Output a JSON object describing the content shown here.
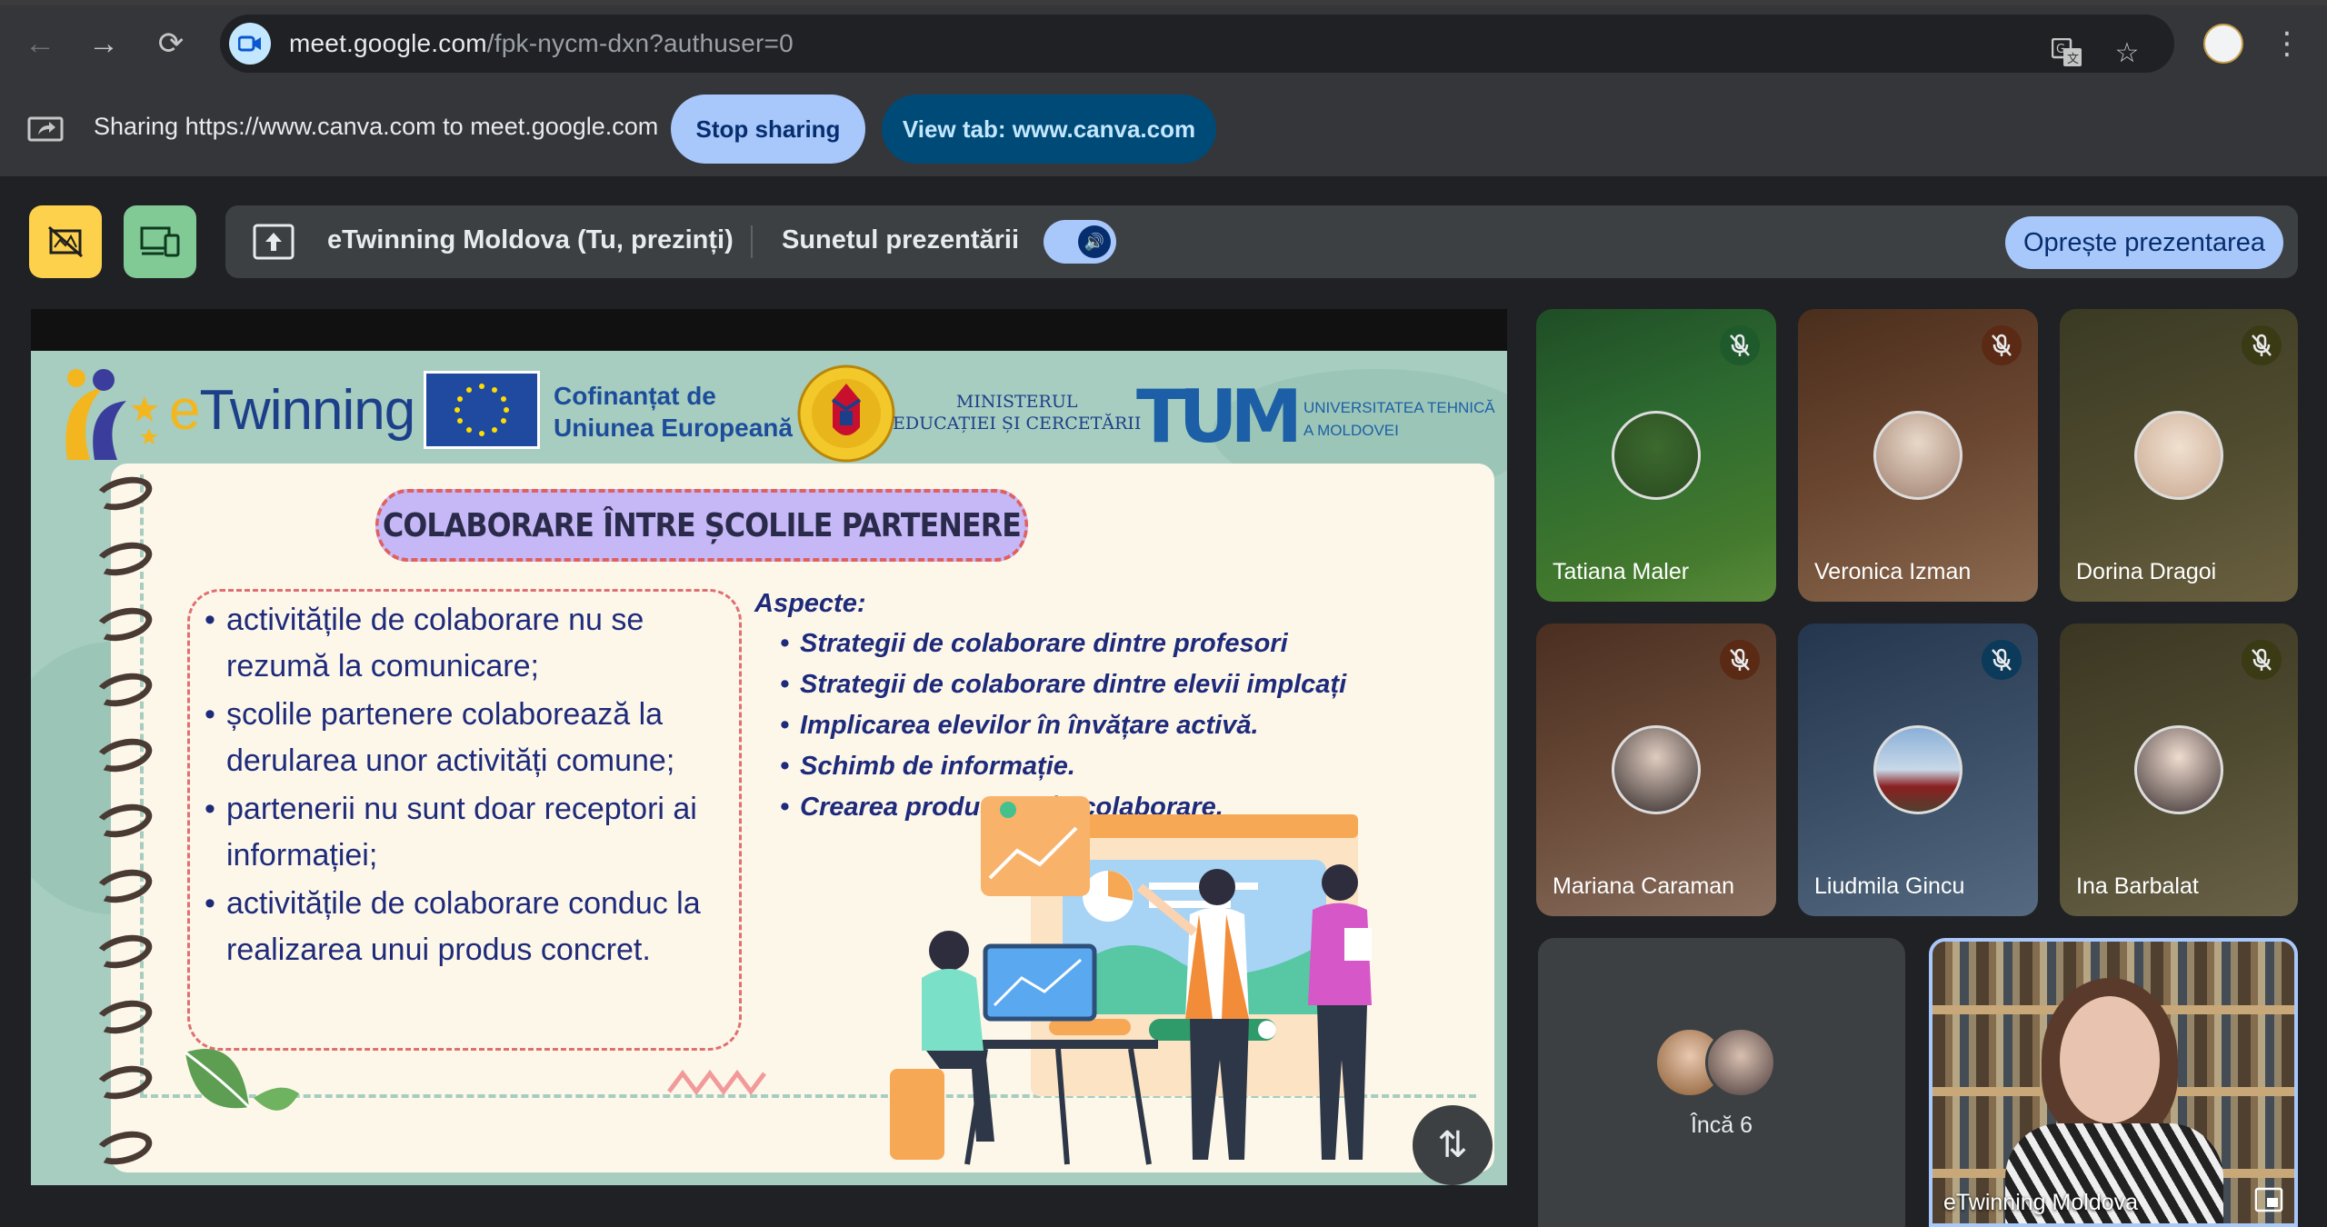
{
  "browser": {
    "url_host": "meet.google.com",
    "url_path": "/fpk-nycm-dxn?authuser=0"
  },
  "sharing": {
    "message": "Sharing https://www.canva.com to meet.google.com",
    "stop_label": "Stop sharing",
    "view_tab_label": "View tab: www.canva.com"
  },
  "presentation_bar": {
    "presenter": "eTwinning Moldova (Tu, prezinți)",
    "audio_label": "Sunetul prezentării",
    "stop_label": "Oprește prezentarea"
  },
  "slide": {
    "brand": "eTwinning",
    "cofinance_line1": "Cofinanțat de",
    "cofinance_line2": "Uniunea Europeană",
    "ministry_line1": "MINISTERUL",
    "ministry_line2": "EDUCAȚIEI ȘI CERCETĂRII",
    "utm_logo": "TUM",
    "utm_line1": "UNIVERSITATEA TEHNICĂ",
    "utm_line2": "A MOLDOVEI",
    "title": "COLABORARE ÎNTRE ȘCOLILE PARTENERE",
    "left_points": [
      "activitățile de colaborare nu se rezumă la comunicare;",
      "școlile partenere colaborează la derularea unor activități comune;",
      "partenerii nu sunt doar receptori ai informației;",
      "activitățile de colaborare conduc la realizarea unui produs concret."
    ],
    "aspects_title": "Aspecte:",
    "aspects": [
      "Strategii de colaborare dintre profesori",
      "Strategii de colaborare dintre elevii implcați",
      "Implicarea elevilor în învățare activă.",
      "Schimb de informație.",
      "Crearea produselor în colaborare."
    ]
  },
  "participants": [
    {
      "name": "Tatiana Maler"
    },
    {
      "name": "Veronica Izman"
    },
    {
      "name": "Dorina Dragoi"
    },
    {
      "name": "Mariana Caraman"
    },
    {
      "name": "Liudmila Gincu"
    },
    {
      "name": "Ina Barbalat"
    }
  ],
  "more_participants": "Încă 6",
  "self_name": "eTwinning Moldova",
  "colors": {
    "accent_blue": "#a8c7fa",
    "dark_blue": "#004a77",
    "yellow_button": "#fdd14b",
    "green_button": "#81c995"
  }
}
